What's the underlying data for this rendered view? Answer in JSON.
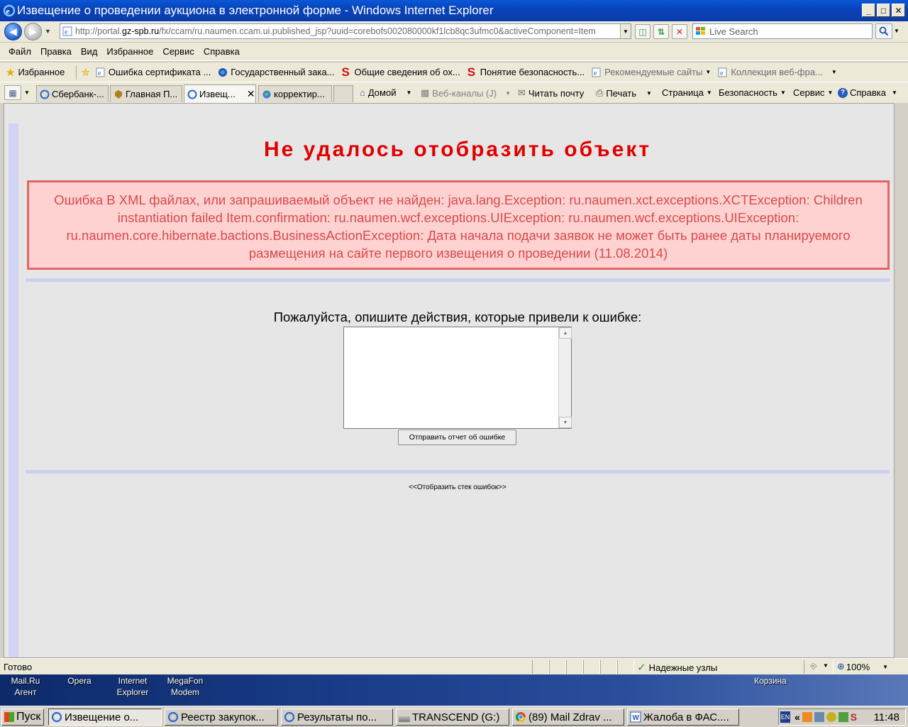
{
  "window": {
    "title": "Извещение о проведении аукциона в электронной форме - Windows Internet Explorer",
    "controls": {
      "minimize": "_",
      "maximize": "□",
      "close": "✕"
    }
  },
  "address": {
    "url_prefix": "http://portal.",
    "url_domain": "gz-spb.ru",
    "url_rest": "/fx/ccam/ru.naumen.ccam.ui.published_jsp?uuid=corebofs002080000kf1lcb8qc3ufmc0&activeComponent=Item",
    "search_placeholder": "Live Search"
  },
  "menu": [
    "Файл",
    "Правка",
    "Вид",
    "Избранное",
    "Сервис",
    "Справка"
  ],
  "favorites": {
    "label": "Избранное",
    "items": [
      {
        "label": "Ошибка сертификата ...",
        "icon": "ie-page-icon",
        "dim": false
      },
      {
        "label": "Государственный зака...",
        "icon": "emblem-icon",
        "dim": false
      },
      {
        "label": "Общие сведения об ох...",
        "icon": "s-logo-icon",
        "dim": false
      },
      {
        "label": "Понятие безопасность...",
        "icon": "s-logo-icon",
        "dim": false
      },
      {
        "label": "Рекомендуемые сайты",
        "icon": "ie-page-icon",
        "dim": true
      },
      {
        "label": "Коллекция веб-фра...",
        "icon": "ie-page-icon",
        "dim": true
      }
    ]
  },
  "tabs": [
    {
      "label": "Сбербанк-...",
      "active": false
    },
    {
      "label": "Главная П...",
      "active": false
    },
    {
      "label": "Извещ...",
      "active": true
    },
    {
      "label": "корректир...",
      "active": false
    }
  ],
  "commands": {
    "home": "Домой",
    "feeds": "Веб-каналы (J)",
    "mail": "Читать почту",
    "print": "Печать",
    "page": "Страница",
    "safety": "Безопасность",
    "tools": "Сервис",
    "help": "Справка"
  },
  "page": {
    "title": "Не удалось отобразить объект",
    "error_message": "Ошибка В XML файлах, или запрашиваемый объект не найден: java.lang.Exception: ru.naumen.xct.exceptions.XCTException: Children instantiation failed Item.confirmation: ru.naumen.wcf.exceptions.UIException: ru.naumen.wcf.exceptions.UIException: ru.naumen.core.hibernate.bactions.BusinessActionException: Дата начала подачи заявок не может быть ранее даты планируемого размещения на сайте первого извещения о проведении (11.08.2014)",
    "describe_label": "Пожалуйста, опишите действия, которые привели к ошибке:",
    "report_text": "",
    "send_button": "Отправить отчет об ошибке",
    "stack_link": "<<Отобразить стек ошибок>>"
  },
  "status": {
    "text": "Готово",
    "zone": "Надежные узлы",
    "zoom": "100%"
  },
  "desktop_icons": [
    {
      "line1": "Mail.Ru",
      "line2": "Агент"
    },
    {
      "line1": "Opera",
      "line2": ""
    },
    {
      "line1": "Internet",
      "line2": "Explorer"
    },
    {
      "line1": "MegaFon",
      "line2": "Modem"
    },
    {
      "line1": "Корзина",
      "line2": ""
    }
  ],
  "taskbar": {
    "start": "Пуск",
    "items": [
      {
        "label": "Извещение о...",
        "active": true
      },
      {
        "label": "Реестр закупок...",
        "active": false
      },
      {
        "label": "Результаты по...",
        "active": false
      },
      {
        "label": "TRANSCEND (G:)",
        "active": false
      },
      {
        "label": "(89) Mail Zdrav ...",
        "active": false
      },
      {
        "label": "Жалоба в ФАС....",
        "active": false
      }
    ],
    "lang": "EN",
    "clock": "11:48"
  },
  "colors": {
    "title_red": "#e00000",
    "error_text": "#d84a4a",
    "error_bg": "#ffd2d2",
    "error_border": "#e46464",
    "divider": "#cfcff2",
    "content_bg": "#e6e6e6"
  }
}
